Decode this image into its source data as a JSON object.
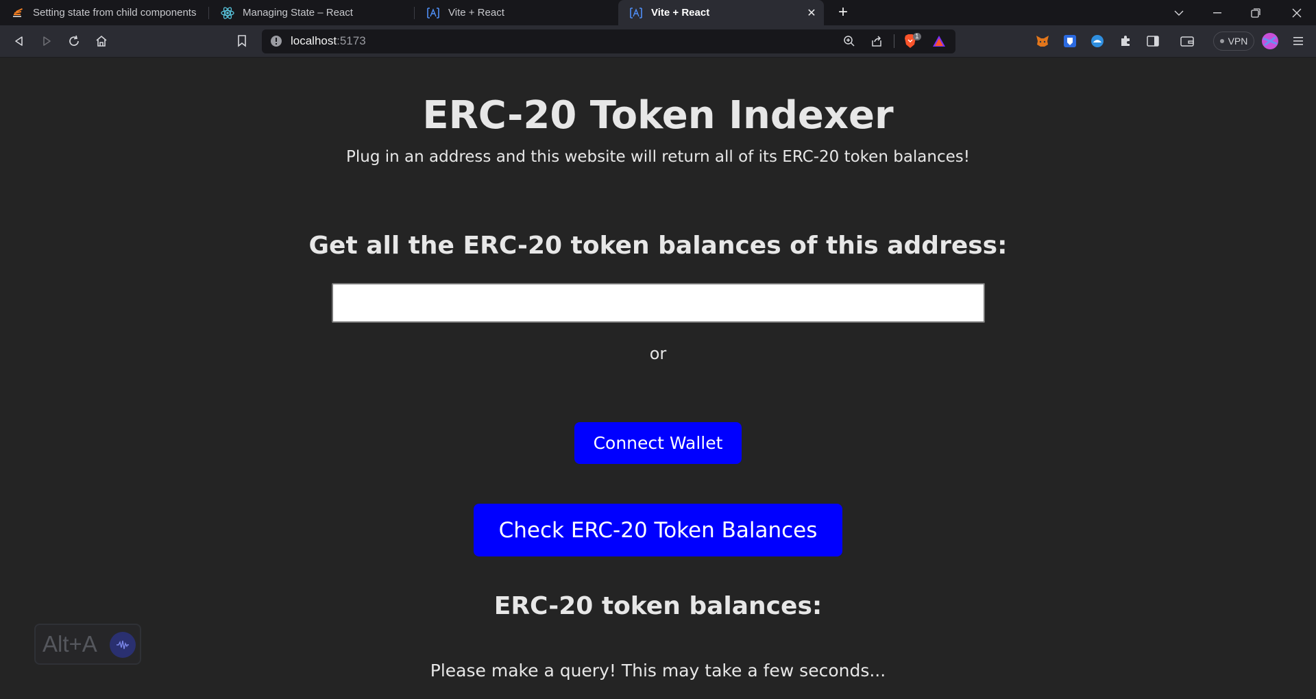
{
  "browser": {
    "tabs": [
      {
        "title": "Setting state from child components",
        "icon": "stackoverflow-icon",
        "active": false
      },
      {
        "title": "Managing State – React",
        "icon": "react-icon",
        "active": false
      },
      {
        "title": "Vite + React",
        "icon": "vite-icon",
        "active": false
      },
      {
        "title": "Vite + React",
        "icon": "vite-icon",
        "active": true
      }
    ],
    "address": {
      "host": "localhost",
      "port": ":5173"
    },
    "vpn_label": "VPN",
    "shields_count": "1"
  },
  "page": {
    "title": "ERC-20 Token Indexer",
    "subtitle": "Plug in an address and this website will return all of its ERC-20 token balances!",
    "prompt": "Get all the ERC-20 token balances of this address:",
    "address_input_value": "",
    "or_text": "or",
    "connect_button": "Connect Wallet",
    "check_button": "Check ERC-20 Token Balances",
    "balances_heading": "ERC-20 token balances:",
    "status_text": "Please make a query! This may take a few seconds..."
  },
  "overlay": {
    "shortcut_label": "Alt+A"
  },
  "colors": {
    "button_blue": "#0000ff",
    "page_bg": "#242424",
    "chrome_bg": "#2b2c33"
  }
}
